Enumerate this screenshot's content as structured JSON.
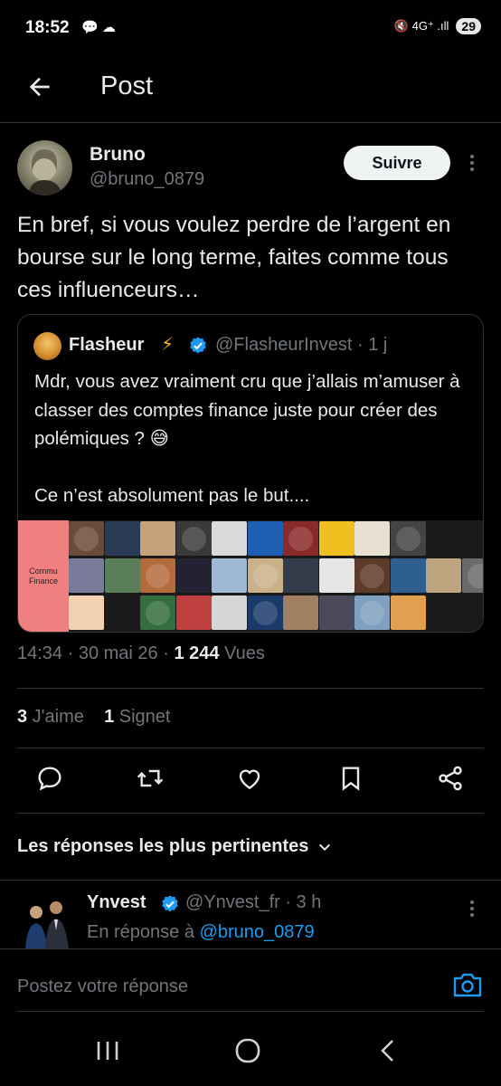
{
  "status_bar": {
    "time": "18:52",
    "left_icons": "💬 ☁",
    "right_icons": "🔇 4G⁺ .ıll",
    "battery": "29"
  },
  "header": {
    "title": "Post"
  },
  "post": {
    "author_name": "Bruno",
    "author_handle": "@bruno_0879",
    "follow_label": "Suivre",
    "text": "En bref, si vous voulez perdre de l’argent en bourse sur le long terme, faites comme tous ces influenceurs…",
    "time": "14:34 · 30 mai 26 · ",
    "views_count": "1 244",
    "views_label": " Vues",
    "likes_count": "3",
    "likes_label": " J'aime",
    "bookmarks_count": "1",
    "bookmarks_label": " Signet"
  },
  "quote": {
    "name": "Flasheur",
    "bolt": "⚡",
    "handle": "@FlasheurInvest · 1 j",
    "text": "Mdr, vous avez vraiment cru que j’allais m’amuser à classer des comptes finance juste pour créer des polémiques ? 😅\n\nCe n’est absolument pas le but....",
    "image_label": "Commu\nFinance"
  },
  "colors": {
    "accent": "#1d9bf0",
    "background": "#000000",
    "text_primary": "#e7e9ea",
    "text_secondary": "#71767b",
    "border": "#2f3336",
    "follow_bg": "#eff3f4",
    "tile_pink": "#f08080"
  },
  "actions": [
    "reply-icon",
    "repost-icon",
    "like-icon",
    "bookmark-icon",
    "share-icon"
  ],
  "replies_section": {
    "sort_label": "Les réponses les plus pertinentes"
  },
  "reply": {
    "name": "Ynvest",
    "handle": "@Ynvest_fr · 3 h",
    "reply_to_prefix": "En réponse à ",
    "reply_to_handle": "@bruno_0879"
  },
  "compose": {
    "placeholder": "Postez votre réponse"
  }
}
